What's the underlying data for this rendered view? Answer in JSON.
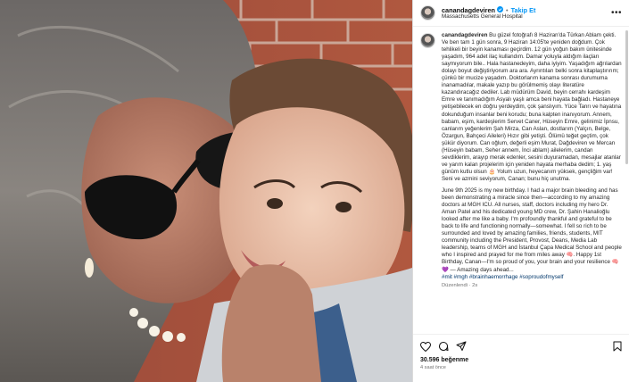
{
  "header": {
    "username": "canandagdeviren",
    "separator": "•",
    "follow_label": "Takip Et",
    "location": "Massachusetts General Hospital",
    "more_label": "•••"
  },
  "caption": {
    "username": "canandagdeviren",
    "text_tr": "Bu güzel fotoğrafı 8 Haziran'da Türkan Ablam çekti. Ve ben tam 1 gün sonra, 9 Haziran 14:05'te yeniden doğdum. Çok tehlikeli bir beyin kanaması geçirdim. 12 gün yoğun bakım ünitesinde yaşadım, 964 adet ilaç kullandım. Damar yoluyla aldığım ilaçları saymıyorum bile.. Hala hastanedeyim, daha iyiyim. Yaşadığım ağrılardan dolayı boyut değiştiriyorum ara ara. Ayrıntıları belki sonra kitaplaştırırım; çünkü bir mucize yaşadım. Doktorlarım kanama sonrası durumuma inanamadılar, makale yazıp bu görülmemiş olayı literatüre kazandıracağız dediler. Lab müdürüm David, beyin cerrahı kardeşim Emre ve tanımadığım Asyalı yaşlı amca beni hayata bağladı. Hastaneye yetişebilecek en doğru yerdeydim, çok şanslıyım. Yüce Tanrı ve hayatına dokunduğum insanlar beni korudu; buna kalpten inanıyorum. Annem, babam, eşim, kardeşlerim Servet Caner, Hüseyin Emre, gelinimiz İpnsu, canlarım yeğenlerim Şah Mirza, Can Aslan, dostlarım (Yalçın, Belge, Özargun, Bahçeci Aileleri) Hızır gibi yetişti. Ölümü teğet geçtim, çok şükür diyorum. Can oğlum, değerli eşim Murat, Dağdeviren ve Mercan (Hüseyin babam, Seher annem, İnci ablam) ailelerim, candan sevdiklerim, arayıp merak edenler, sesini duyuramadan, mesajlar atanlar ve yarım kalan projelerim için yeniden hayata merhaba dedim; 1. yaş günüm kutlu olsun 🎂 Yolum uzun, heyecanım yüksek, gençliğim var! Seni ve azmini seviyorum, Canan; bunu hiç unutma.",
    "text_en": "June 9th 2025 is my new birthday. I had a major brain bleeding and has been demonstrating a miracle since then—according to my amazing doctors at MGH ICU. All nurses, staff, doctors including my hero Dr. Aman Patel and his dedicated young MD crew, Dr. Şahin Hanalioğlu looked after me like a baby. I'm profoundly thankful and grateful to be back to life and functioning normally—somewhat. I fell so rich to be surrounded and loved by amazing families, friends, students, MIT community including the President, Provost, Deans, Media Lab leadership, teams of MGH and İstanbul Çapa Medical School and people who I inspired and prayed for me from miles away 🧠. Happy 1st Birthday, Canan—I'm so proud of you, your brain and your resilience 🧠💜 — Amazing days ahead...",
    "hashtags": "#mit #mgh #brainhaemorrhage #soproudofmyself",
    "edited": "Düzenlendi · 2s"
  },
  "engagement": {
    "likes_count": "30.596",
    "likes_label": "beğenme",
    "time_ago": "4 saat önce"
  },
  "icons": {
    "verified": "verified-badge-icon",
    "more": "more-options-icon",
    "like": "heart-icon",
    "comment": "comment-icon",
    "share": "share-icon",
    "save": "bookmark-icon"
  },
  "colors": {
    "accent": "#0095f6",
    "hashtag": "#00376b",
    "muted": "#737373"
  }
}
